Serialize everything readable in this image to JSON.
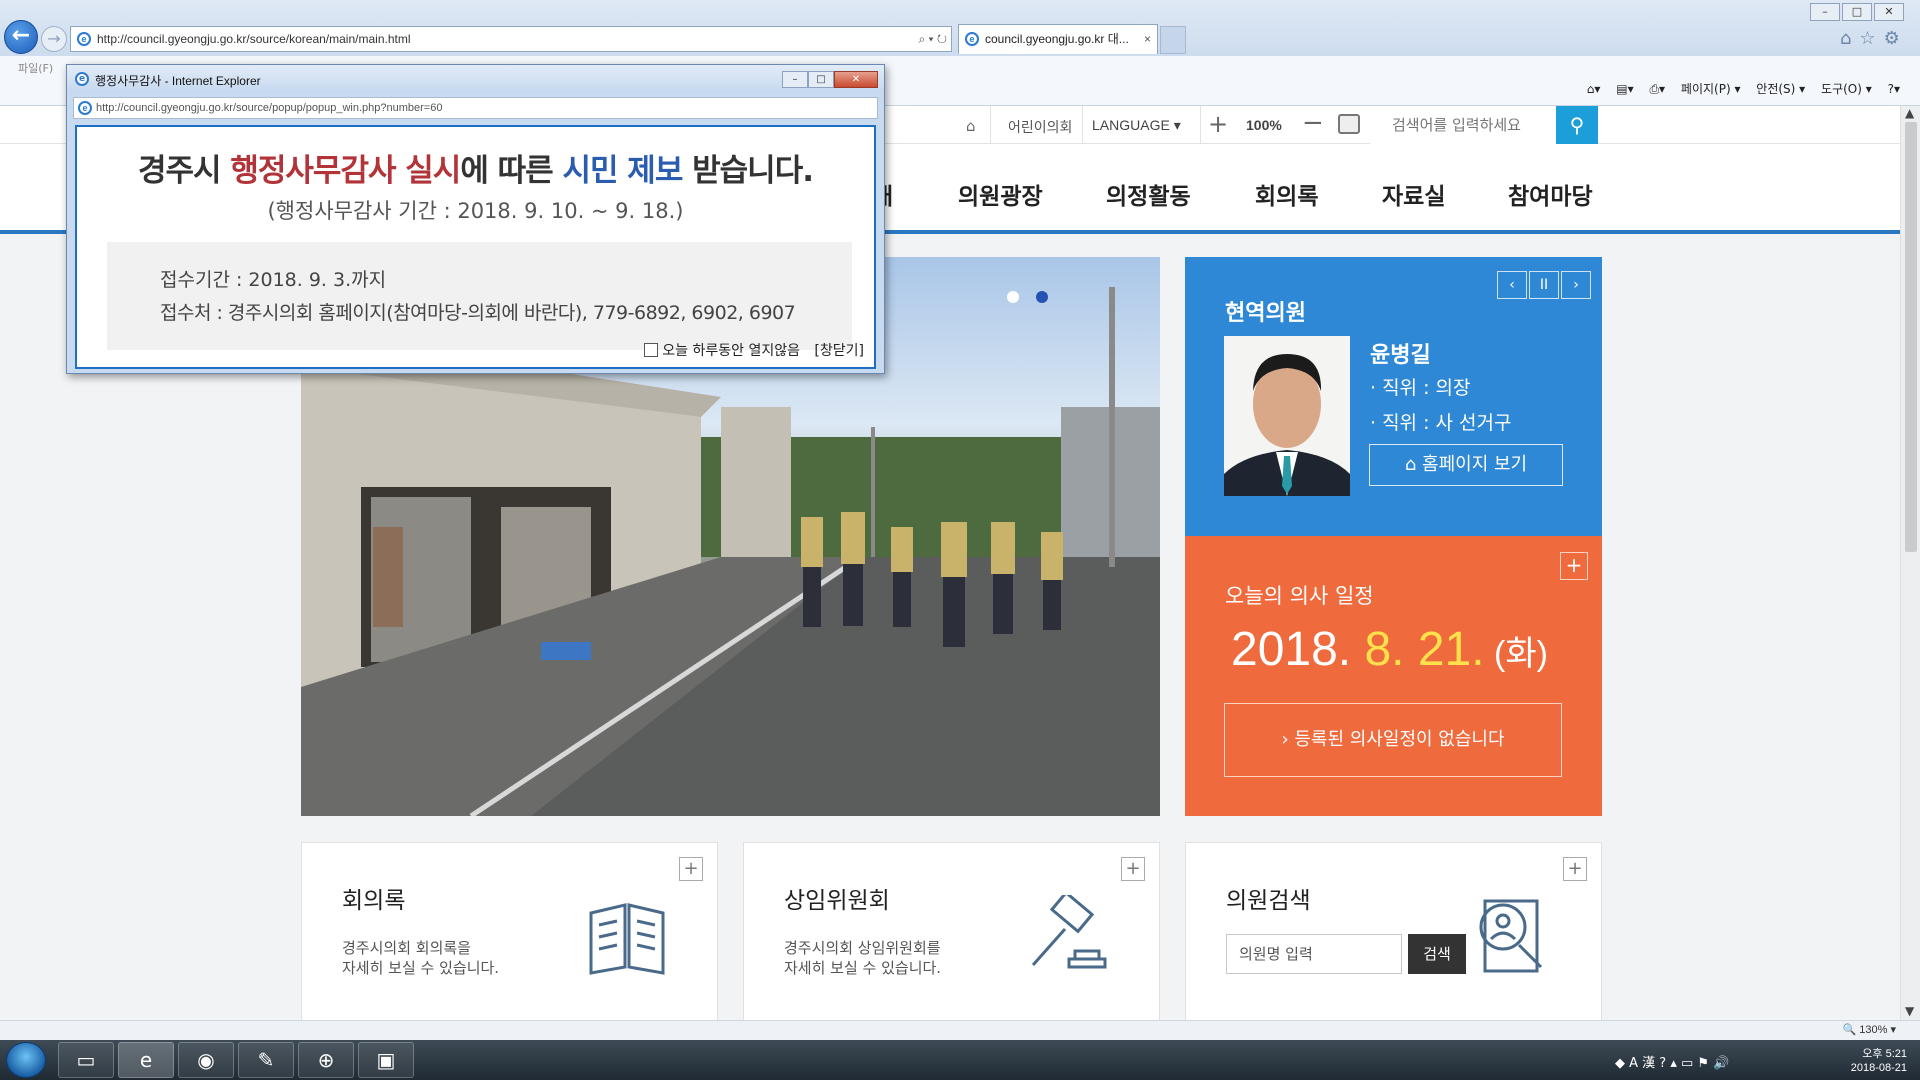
{
  "browser": {
    "url": "http://council.gyeongju.go.kr/source/korean/main/main.html",
    "tab_title": "council.gyeongju.go.kr 대...",
    "tab_close": "×",
    "menu_file": "파일(F)",
    "commands": [
      "페이지(P) ▾",
      "안전(S) ▾",
      "도구(O) ▾"
    ],
    "status_zoom": "🔍 130%   ▾"
  },
  "utility": {
    "kids_council": "어린이의회",
    "language": "LANGUAGE ▾",
    "zoom_plus": "+",
    "zoom_level": "100%",
    "zoom_minus": "−",
    "search_placeholder": "검색어를 입력하세요"
  },
  "gnb": {
    "partial_first": "개",
    "items": [
      "의원광장",
      "의정활동",
      "회의록",
      "자료실",
      "참여마당"
    ]
  },
  "member": {
    "section_title": "현역의원",
    "prev": "‹",
    "pause": "II",
    "next": "›",
    "name": "윤병길",
    "position1": "· 직위 : 의장",
    "position2": "· 직위 : 사 선거구",
    "homepage_button": "⌂ 홈페이지 보기"
  },
  "schedule": {
    "title": "오늘의 의사 일정",
    "year": "2018.",
    "month": " 8.",
    "day": " 21.",
    "dow": " (화)",
    "empty_message": "› 등록된 의사일정이 없습니다",
    "plus": "+"
  },
  "cards": [
    {
      "title": "회의록",
      "desc": "경주시의회 회의록을\n자세히 보실 수 있습니다.",
      "plus": "+"
    },
    {
      "title": "상임위원회",
      "desc": "경주시의회 상임위원회를\n자세히 보실 수 있습니다.",
      "plus": "+"
    },
    {
      "title": "의원검색",
      "input_placeholder": "의원명 입력",
      "button": "검색",
      "plus": "+"
    }
  ],
  "popup": {
    "window_title": "행정사무감사 - Internet Explorer",
    "url": "http://council.gyeongju.go.kr/source/popup/popup_win.php?number=60",
    "heading_pre": "경주시 ",
    "heading_red": "행정사무감사 실시",
    "heading_mid": "에 따른 ",
    "heading_blue": "시민 제보",
    "heading_post": " 받습니다.",
    "period": "(행정사무감사 기간 : 2018. 9. 10. ~ 9. 18.)",
    "line1": "접수기간 : 2018. 9. 3.까지",
    "line2": "접수처 : 경주시의회 홈페이지(참여마당-의회에 바란다), 779-6892, 6902, 6907",
    "no_show_today": "오늘 하루동안 열지않음",
    "close_link": "[창닫기]"
  },
  "taskbar": {
    "clock_time": "오후 5:21",
    "clock_date": "2018-08-21",
    "ime": "A 漢"
  }
}
